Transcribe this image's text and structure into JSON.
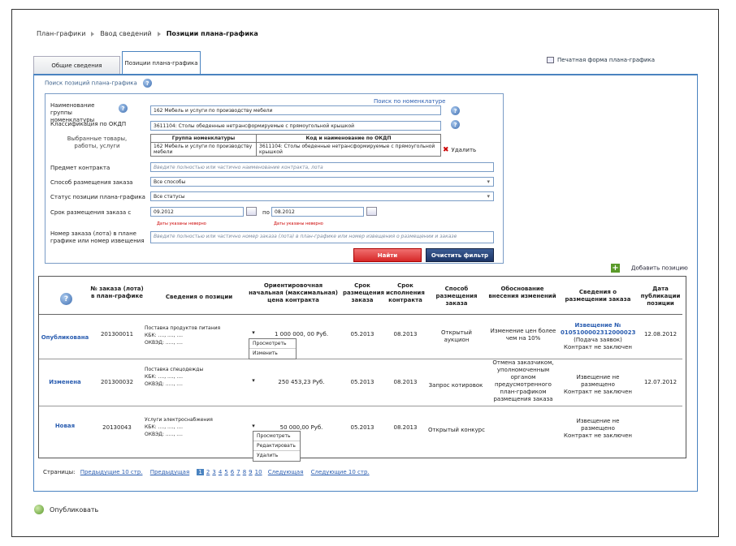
{
  "breadcrumb": {
    "items": [
      "План-графики",
      "Ввод сведений"
    ],
    "current": "Позиции плана-графика"
  },
  "tabs": [
    "Общие сведения",
    "Позиции плана-графика"
  ],
  "print_link": "Печатная форма плана-графика",
  "search": {
    "title": "Поиск позиций плана-графика",
    "nomenclature_link": "Поиск по номенклатуре",
    "group_label": "Наименование группы номенклатуры",
    "group_value": "162 Мебель и услуги по производству мебели",
    "okdp_label": "Классификация по ОКДП",
    "okdp_value": "3611104: Столы обеденные нетрансформируемые с прямоугольной крышкой",
    "selected_label": "Выбранные товары, работы, услуги",
    "selected_headers": [
      "Группа номенклатуры",
      "Код и наименование по ОКДП"
    ],
    "selected_row": [
      "162 Мебель и услуги по производству мебели",
      "3611104: Столы обеденные нетрансформируемые с прямоугольной крышкой"
    ],
    "delete_label": "Удалить",
    "subject_label": "Предмет контракта",
    "subject_placeholder": "Введите полностью или частично наименование контракта, лота",
    "method_label": "Способ размещения заказа",
    "method_value": "Все способы",
    "status_label": "Статус позиции плана-графика",
    "status_value": "Все статусы",
    "term_label": "Срок размещения заказа с",
    "term_from": "09.2012",
    "term_to_label": "по",
    "term_to": "08.2012",
    "error_text": "Даты указаны неверно",
    "order_label": "Номер заказа (лота) в плане графике или номер извещения",
    "order_placeholder": "Введите полностью или частично номер заказа (лота) в план-графике или номер извещения о размещении и заказе",
    "find_button": "Найти",
    "clear_button": "Очистить фильтр"
  },
  "add_position": "Добавить позицию",
  "table": {
    "headers": [
      "№ заказа (лота) в план-графике",
      "Сведения о позиции",
      "Ориентировочная начальная (максимальная) цена контракта",
      "Срок размещения заказа",
      "Срок исполнения контракта",
      "Способ размещения заказа",
      "Обоснование внесения изменений",
      "Сведения о размещении заказа",
      "Дата публикации позиции"
    ],
    "rows": [
      {
        "status": "Опубликована",
        "num": "201300011",
        "name": "Поставка продуктов питания",
        "kbk": "КБК: ...., ...., ....",
        "okved": "ОКВЭД: ....., ....",
        "price": "1 000 000, 00 Руб.",
        "term": "05.2013",
        "exec": "08.2013",
        "method": "Открытый аукцион",
        "reason": "Изменение цен более чем на 10%",
        "placement_link": "Извещение № 0105100002312000023",
        "placement_line2": "(Подача заявок)",
        "placement_line3": "Контракт не заключен",
        "date": "12.08.2012"
      },
      {
        "status": "Изменена",
        "num": "201300032",
        "name": "Поставка спецодежды",
        "kbk": "КБК: ...., ...., ....",
        "okved": "ОКВЭД: ....., ....",
        "price": "250 453,23 Руб.",
        "term": "05.2013",
        "exec": "08.2013",
        "method": "Запрос котировок",
        "reason": "Отмена заказчиком, уполномоченным органом предусмотренного план-графиком размещения заказа",
        "placement_line1": "Извещение не размещено",
        "placement_line3": "Контракт не заключен",
        "date": "12.07.2012"
      },
      {
        "status": "Новая",
        "num": "20130043",
        "name": "Услуги электроснабжения",
        "kbk": "КБК: ...., ...., ....",
        "okved": "ОКВЭД: ....., ....",
        "price": "50 000,00 Руб.",
        "term": "05.2013",
        "exec": "08.2013",
        "method": "Открытый конкурс",
        "reason": "",
        "placement_line1": "Извещение не размещено",
        "placement_line3": "Контракт не заключен",
        "date": ""
      }
    ]
  },
  "menu1": [
    "Просмотреть",
    "Изменить"
  ],
  "menu2": [
    "Просмотреть",
    "Редактировать",
    "Удалить"
  ],
  "pagination": {
    "label": "Страницы:",
    "prev10": "Предыдущие 10 стр.",
    "prev": "Предыдущая",
    "pages": [
      "1",
      "2",
      "3",
      "4",
      "5",
      "6",
      "7",
      "8",
      "9",
      "10"
    ],
    "next": "Следующая",
    "next10": "Следующие 10 стр."
  },
  "publish": "Опубликовать"
}
